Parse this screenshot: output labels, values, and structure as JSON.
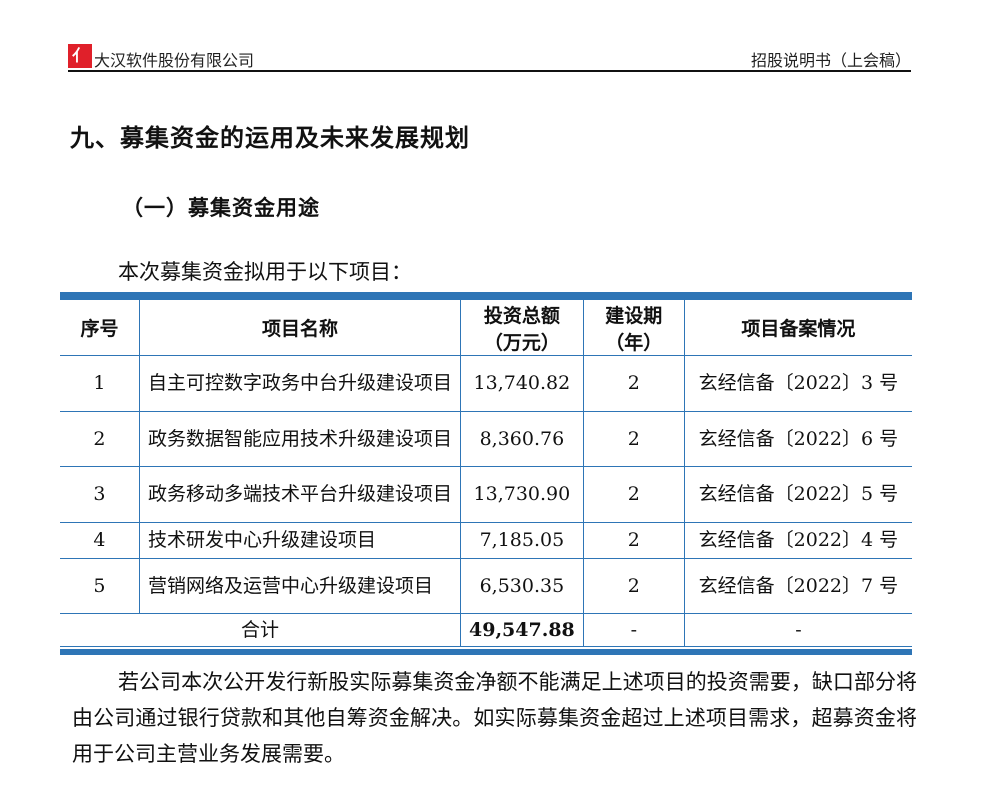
{
  "header": {
    "logo_text": "大",
    "company": "大汉软件股份有限公司",
    "document": "招股说明书（上会稿）"
  },
  "section_title": "九、募集资金的运用及未来发展规划",
  "subsection_title": "（一）募集资金用途",
  "intro": "本次募集资金拟用于以下项目：",
  "table": {
    "headers": [
      "序号",
      "项目名称",
      "投资总额（万元）",
      "建设期（年）",
      "项目备案情况"
    ],
    "rows": [
      {
        "no": "1",
        "name": "自主可控数字政务中台升级建设项目",
        "amount": "13,740.82",
        "period": "2",
        "filing": "玄经信备〔2022〕3 号"
      },
      {
        "no": "2",
        "name": "政务数据智能应用技术升级建设项目",
        "amount": "8,360.76",
        "period": "2",
        "filing": "玄经信备〔2022〕6 号"
      },
      {
        "no": "3",
        "name": "政务移动多端技术平台升级建设项目",
        "amount": "13,730.90",
        "period": "2",
        "filing": "玄经信备〔2022〕5 号"
      },
      {
        "no": "4",
        "name": "技术研发中心升级建设项目",
        "amount": "7,185.05",
        "period": "2",
        "filing": "玄经信备〔2022〕4 号"
      },
      {
        "no": "5",
        "name": "营销网络及运营中心升级建设项目",
        "amount": "6,530.35",
        "period": "2",
        "filing": "玄经信备〔2022〕7 号"
      }
    ],
    "total": {
      "label": "合计",
      "amount": "49,547.88",
      "period": "-",
      "filing": "-"
    }
  },
  "paragraph": "若公司本次公开发行新股实际募集资金净额不能满足上述项目的投资需要，缺口部分将由公司通过银行贷款和其他自筹资金解决。如实际募集资金超过上述项目需求，超募资金将用于公司主营业务发展需要。"
}
